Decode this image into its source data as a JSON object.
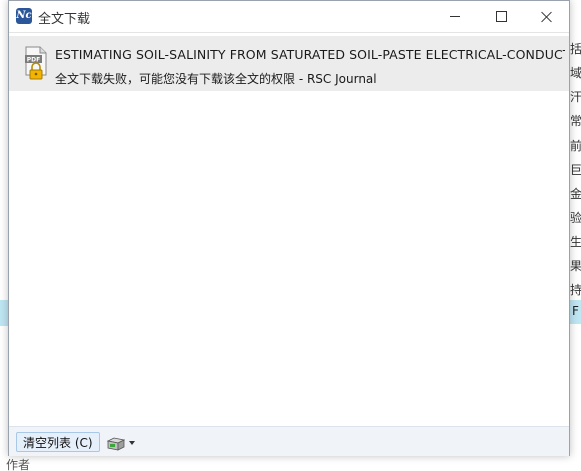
{
  "window": {
    "title": "全文下载",
    "app_icon_letters": "Nc"
  },
  "downloads": [
    {
      "title": "ESTIMATING SOIL-SALINITY FROM SATURATED SOIL-PASTE ELECTRICAL-CONDUCTIVITY",
      "status": "全文下载失败，可能您没有下载该全文的权限  -  RSC Journal",
      "icon": "pdf-locked-icon"
    }
  ],
  "footer": {
    "clear_label": "清空列表 (C)",
    "tool_icon": "device-dropdown-icon"
  },
  "background": {
    "right_glyphs": [
      "括",
      "域",
      "汗",
      "常",
      "前",
      "巨",
      "金",
      "验",
      "生",
      "果",
      "持"
    ],
    "right_band_glyph": "F",
    "left_band_glyph": "",
    "bottom_text": "作者"
  },
  "colors": {
    "accent": "#2b579a",
    "selection_band": "#bfe6f3",
    "item_background": "#ececec"
  }
}
